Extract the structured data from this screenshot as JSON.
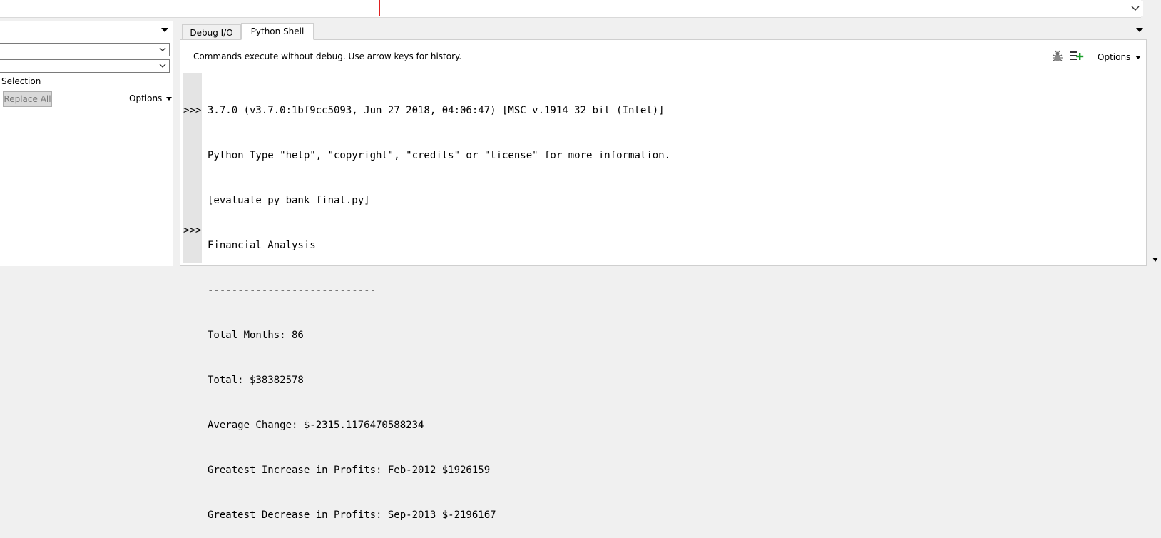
{
  "left_panel": {
    "search_value": "",
    "replace_value": "",
    "selection_label": "Selection",
    "replace_all_label": "Replace All",
    "options_label": "Options"
  },
  "tabs": [
    {
      "label": "Debug I/O",
      "active": false
    },
    {
      "label": "Python Shell",
      "active": true
    }
  ],
  "shell": {
    "hint": "Commands execute without debug.  Use arrow keys for history.",
    "options_label": "Options",
    "prompt": ">>>",
    "lines": [
      "3.7.0 (v3.7.0:1bf9cc5093, Jun 27 2018, 04:06:47) [MSC v.1914 32 bit (Intel)]",
      "Python Type \"help\", \"copyright\", \"credits\" or \"license\" for more information.",
      "[evaluate py bank final.py]",
      "Financial Analysis",
      "----------------------------",
      "Total Months: 86",
      "Total: $38382578",
      "Average Change: $-2315.1176470588234",
      "Greatest Increase in Profits: Feb-2012 $1926159",
      "Greatest Decrease in Profits: Sep-2013 $-2196167"
    ]
  },
  "icons": {
    "bug": "bug-icon",
    "add": "add-to-list-icon",
    "accent_green": "#1a9e2a",
    "caret_red": "#e02020"
  }
}
